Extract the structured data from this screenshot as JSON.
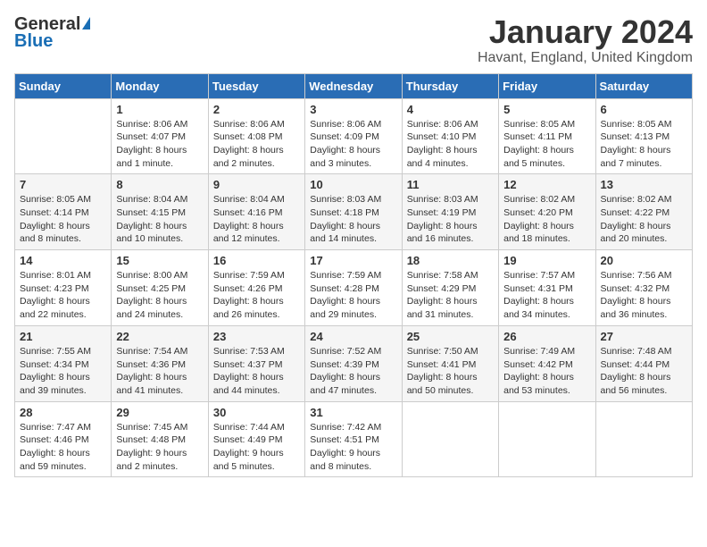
{
  "header": {
    "logo_general": "General",
    "logo_blue": "Blue",
    "month_title": "January 2024",
    "location": "Havant, England, United Kingdom"
  },
  "weekdays": [
    "Sunday",
    "Monday",
    "Tuesday",
    "Wednesday",
    "Thursday",
    "Friday",
    "Saturday"
  ],
  "weeks": [
    [
      {
        "day": "",
        "sunrise": "",
        "sunset": "",
        "daylight": ""
      },
      {
        "day": "1",
        "sunrise": "Sunrise: 8:06 AM",
        "sunset": "Sunset: 4:07 PM",
        "daylight": "Daylight: 8 hours and 1 minute."
      },
      {
        "day": "2",
        "sunrise": "Sunrise: 8:06 AM",
        "sunset": "Sunset: 4:08 PM",
        "daylight": "Daylight: 8 hours and 2 minutes."
      },
      {
        "day": "3",
        "sunrise": "Sunrise: 8:06 AM",
        "sunset": "Sunset: 4:09 PM",
        "daylight": "Daylight: 8 hours and 3 minutes."
      },
      {
        "day": "4",
        "sunrise": "Sunrise: 8:06 AM",
        "sunset": "Sunset: 4:10 PM",
        "daylight": "Daylight: 8 hours and 4 minutes."
      },
      {
        "day": "5",
        "sunrise": "Sunrise: 8:05 AM",
        "sunset": "Sunset: 4:11 PM",
        "daylight": "Daylight: 8 hours and 5 minutes."
      },
      {
        "day": "6",
        "sunrise": "Sunrise: 8:05 AM",
        "sunset": "Sunset: 4:13 PM",
        "daylight": "Daylight: 8 hours and 7 minutes."
      }
    ],
    [
      {
        "day": "7",
        "sunrise": "Sunrise: 8:05 AM",
        "sunset": "Sunset: 4:14 PM",
        "daylight": "Daylight: 8 hours and 8 minutes."
      },
      {
        "day": "8",
        "sunrise": "Sunrise: 8:04 AM",
        "sunset": "Sunset: 4:15 PM",
        "daylight": "Daylight: 8 hours and 10 minutes."
      },
      {
        "day": "9",
        "sunrise": "Sunrise: 8:04 AM",
        "sunset": "Sunset: 4:16 PM",
        "daylight": "Daylight: 8 hours and 12 minutes."
      },
      {
        "day": "10",
        "sunrise": "Sunrise: 8:03 AM",
        "sunset": "Sunset: 4:18 PM",
        "daylight": "Daylight: 8 hours and 14 minutes."
      },
      {
        "day": "11",
        "sunrise": "Sunrise: 8:03 AM",
        "sunset": "Sunset: 4:19 PM",
        "daylight": "Daylight: 8 hours and 16 minutes."
      },
      {
        "day": "12",
        "sunrise": "Sunrise: 8:02 AM",
        "sunset": "Sunset: 4:20 PM",
        "daylight": "Daylight: 8 hours and 18 minutes."
      },
      {
        "day": "13",
        "sunrise": "Sunrise: 8:02 AM",
        "sunset": "Sunset: 4:22 PM",
        "daylight": "Daylight: 8 hours and 20 minutes."
      }
    ],
    [
      {
        "day": "14",
        "sunrise": "Sunrise: 8:01 AM",
        "sunset": "Sunset: 4:23 PM",
        "daylight": "Daylight: 8 hours and 22 minutes."
      },
      {
        "day": "15",
        "sunrise": "Sunrise: 8:00 AM",
        "sunset": "Sunset: 4:25 PM",
        "daylight": "Daylight: 8 hours and 24 minutes."
      },
      {
        "day": "16",
        "sunrise": "Sunrise: 7:59 AM",
        "sunset": "Sunset: 4:26 PM",
        "daylight": "Daylight: 8 hours and 26 minutes."
      },
      {
        "day": "17",
        "sunrise": "Sunrise: 7:59 AM",
        "sunset": "Sunset: 4:28 PM",
        "daylight": "Daylight: 8 hours and 29 minutes."
      },
      {
        "day": "18",
        "sunrise": "Sunrise: 7:58 AM",
        "sunset": "Sunset: 4:29 PM",
        "daylight": "Daylight: 8 hours and 31 minutes."
      },
      {
        "day": "19",
        "sunrise": "Sunrise: 7:57 AM",
        "sunset": "Sunset: 4:31 PM",
        "daylight": "Daylight: 8 hours and 34 minutes."
      },
      {
        "day": "20",
        "sunrise": "Sunrise: 7:56 AM",
        "sunset": "Sunset: 4:32 PM",
        "daylight": "Daylight: 8 hours and 36 minutes."
      }
    ],
    [
      {
        "day": "21",
        "sunrise": "Sunrise: 7:55 AM",
        "sunset": "Sunset: 4:34 PM",
        "daylight": "Daylight: 8 hours and 39 minutes."
      },
      {
        "day": "22",
        "sunrise": "Sunrise: 7:54 AM",
        "sunset": "Sunset: 4:36 PM",
        "daylight": "Daylight: 8 hours and 41 minutes."
      },
      {
        "day": "23",
        "sunrise": "Sunrise: 7:53 AM",
        "sunset": "Sunset: 4:37 PM",
        "daylight": "Daylight: 8 hours and 44 minutes."
      },
      {
        "day": "24",
        "sunrise": "Sunrise: 7:52 AM",
        "sunset": "Sunset: 4:39 PM",
        "daylight": "Daylight: 8 hours and 47 minutes."
      },
      {
        "day": "25",
        "sunrise": "Sunrise: 7:50 AM",
        "sunset": "Sunset: 4:41 PM",
        "daylight": "Daylight: 8 hours and 50 minutes."
      },
      {
        "day": "26",
        "sunrise": "Sunrise: 7:49 AM",
        "sunset": "Sunset: 4:42 PM",
        "daylight": "Daylight: 8 hours and 53 minutes."
      },
      {
        "day": "27",
        "sunrise": "Sunrise: 7:48 AM",
        "sunset": "Sunset: 4:44 PM",
        "daylight": "Daylight: 8 hours and 56 minutes."
      }
    ],
    [
      {
        "day": "28",
        "sunrise": "Sunrise: 7:47 AM",
        "sunset": "Sunset: 4:46 PM",
        "daylight": "Daylight: 8 hours and 59 minutes."
      },
      {
        "day": "29",
        "sunrise": "Sunrise: 7:45 AM",
        "sunset": "Sunset: 4:48 PM",
        "daylight": "Daylight: 9 hours and 2 minutes."
      },
      {
        "day": "30",
        "sunrise": "Sunrise: 7:44 AM",
        "sunset": "Sunset: 4:49 PM",
        "daylight": "Daylight: 9 hours and 5 minutes."
      },
      {
        "day": "31",
        "sunrise": "Sunrise: 7:42 AM",
        "sunset": "Sunset: 4:51 PM",
        "daylight": "Daylight: 9 hours and 8 minutes."
      },
      {
        "day": "",
        "sunrise": "",
        "sunset": "",
        "daylight": ""
      },
      {
        "day": "",
        "sunrise": "",
        "sunset": "",
        "daylight": ""
      },
      {
        "day": "",
        "sunrise": "",
        "sunset": "",
        "daylight": ""
      }
    ]
  ]
}
